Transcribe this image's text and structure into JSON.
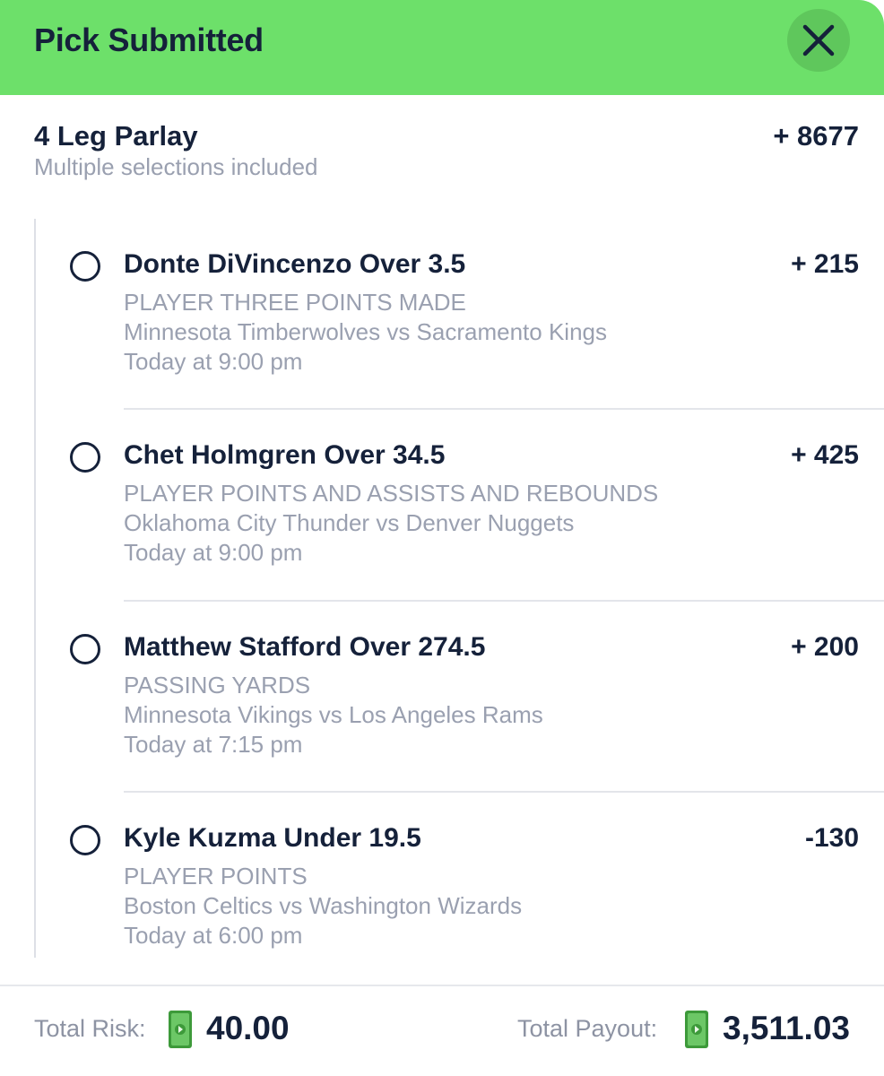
{
  "header": {
    "title": "Pick Submitted",
    "background_color": "#6de06a",
    "close_icon": "close-icon"
  },
  "parlay": {
    "title": "4 Leg Parlay",
    "subtitle": "Multiple selections included",
    "odds": "+ 8677"
  },
  "legs": [
    {
      "name": "Donte DiVincenzo Over 3.5",
      "odds": "+ 215",
      "market": "PLAYER THREE POINTS MADE",
      "matchup": "Minnesota Timberwolves vs Sacramento Kings",
      "time": "Today at 9:00 pm"
    },
    {
      "name": "Chet Holmgren Over 34.5",
      "odds": "+ 425",
      "market": "PLAYER POINTS AND ASSISTS AND REBOUNDS",
      "matchup": "Oklahoma City Thunder vs Denver Nuggets",
      "time": "Today at 9:00 pm"
    },
    {
      "name": "Matthew Stafford Over 274.5",
      "odds": "+ 200",
      "market": "PASSING YARDS",
      "matchup": "Minnesota Vikings vs Los Angeles Rams",
      "time": "Today at 7:15 pm"
    },
    {
      "name": "Kyle Kuzma Under 19.5",
      "odds": "-130",
      "market": "PLAYER POINTS",
      "matchup": "Boston Celtics vs Washington Wizards",
      "time": "Today at 6:00 pm"
    }
  ],
  "footer": {
    "risk_label": "Total Risk:",
    "risk_value": "40.00",
    "payout_label": "Total Payout:",
    "payout_value": "3,511.03",
    "money_icon": "dollar-bill-icon"
  }
}
